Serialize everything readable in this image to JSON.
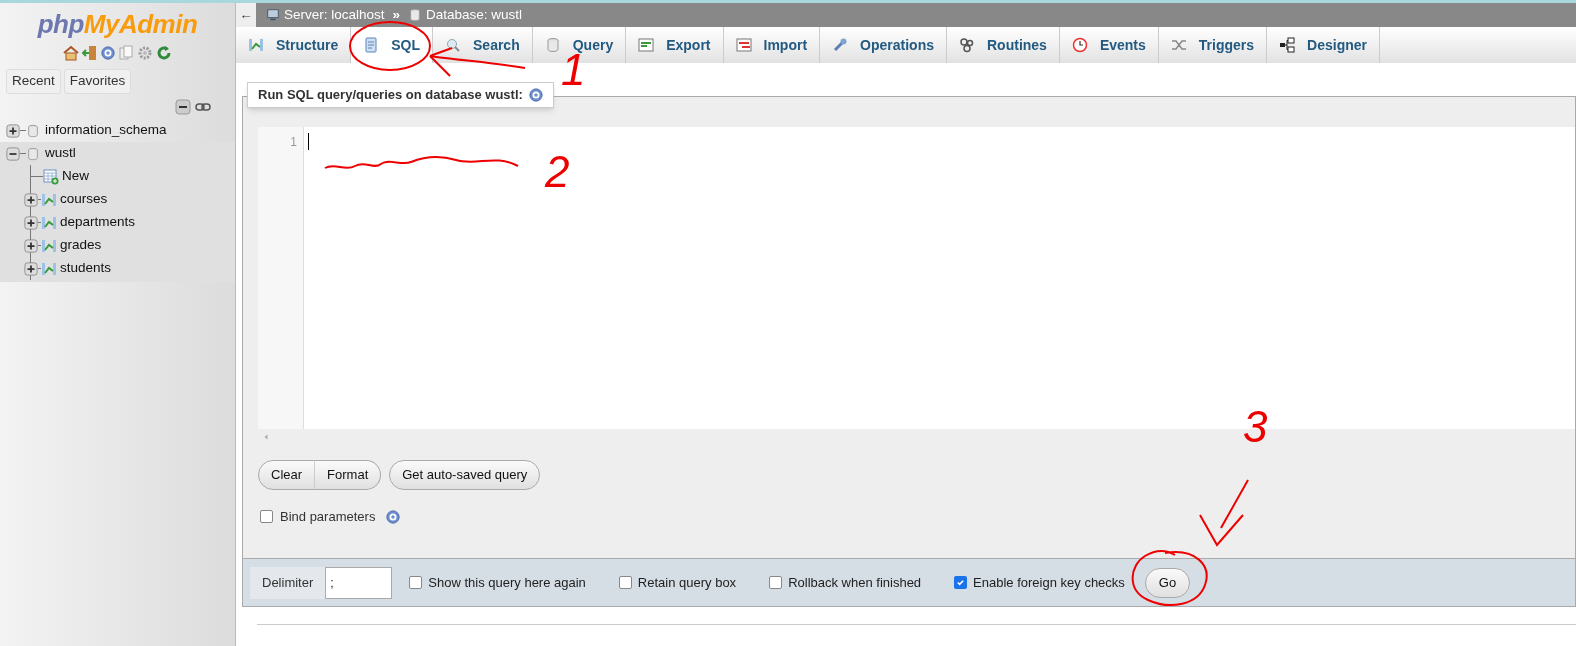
{
  "logo_parts": [
    "php",
    "MyAdmin"
  ],
  "sidebar": {
    "buttons": [
      "Recent",
      "Favorites"
    ],
    "tree": [
      {
        "label": "information_schema",
        "kind": "database",
        "expanded": false,
        "selected": false
      },
      {
        "label": "wustl",
        "kind": "database",
        "expanded": true,
        "selected": true,
        "children": [
          {
            "label": "New",
            "kind": "new"
          },
          {
            "label": "courses",
            "kind": "table"
          },
          {
            "label": "departments",
            "kind": "table"
          },
          {
            "label": "grades",
            "kind": "table"
          },
          {
            "label": "students",
            "kind": "table"
          }
        ]
      }
    ]
  },
  "breadcrumb": {
    "back": "←",
    "items": [
      "Server: localhost",
      "Database: wustl"
    ],
    "separator": "»"
  },
  "tabs": [
    {
      "label": "Structure",
      "selected": false
    },
    {
      "label": "SQL",
      "selected": true
    },
    {
      "label": "Search",
      "selected": false
    },
    {
      "label": "Query",
      "selected": false
    },
    {
      "label": "Export",
      "selected": false
    },
    {
      "label": "Import",
      "selected": false
    },
    {
      "label": "Operations",
      "selected": false
    },
    {
      "label": "Routines",
      "selected": false
    },
    {
      "label": "Events",
      "selected": false
    },
    {
      "label": "Triggers",
      "selected": false
    },
    {
      "label": "Designer",
      "selected": false
    }
  ],
  "panel_title": "Run SQL query/queries on database wustl:",
  "editor": {
    "line_numbers": [
      "1"
    ]
  },
  "buttons": [
    "Clear",
    "Format",
    "Get auto-saved query"
  ],
  "bind_parameters": {
    "label": "Bind parameters",
    "checked": false
  },
  "footer": {
    "delimiter_label": "Delimiter",
    "delimiter_value": ";",
    "options": [
      {
        "label": "Show this query here again",
        "checked": false
      },
      {
        "label": "Retain query box",
        "checked": false
      },
      {
        "label": "Rollback when finished",
        "checked": false
      },
      {
        "label": "Enable foreign key checks",
        "checked": true
      }
    ],
    "go": "Go"
  },
  "annotations": [
    {
      "kind": "circle"
    },
    {
      "kind": "arrow"
    },
    {
      "kind": "number",
      "text": "1"
    },
    {
      "kind": "scribble"
    },
    {
      "kind": "number",
      "text": "2"
    },
    {
      "kind": "number",
      "text": "3"
    },
    {
      "kind": "check-arrow"
    },
    {
      "kind": "circle"
    }
  ]
}
